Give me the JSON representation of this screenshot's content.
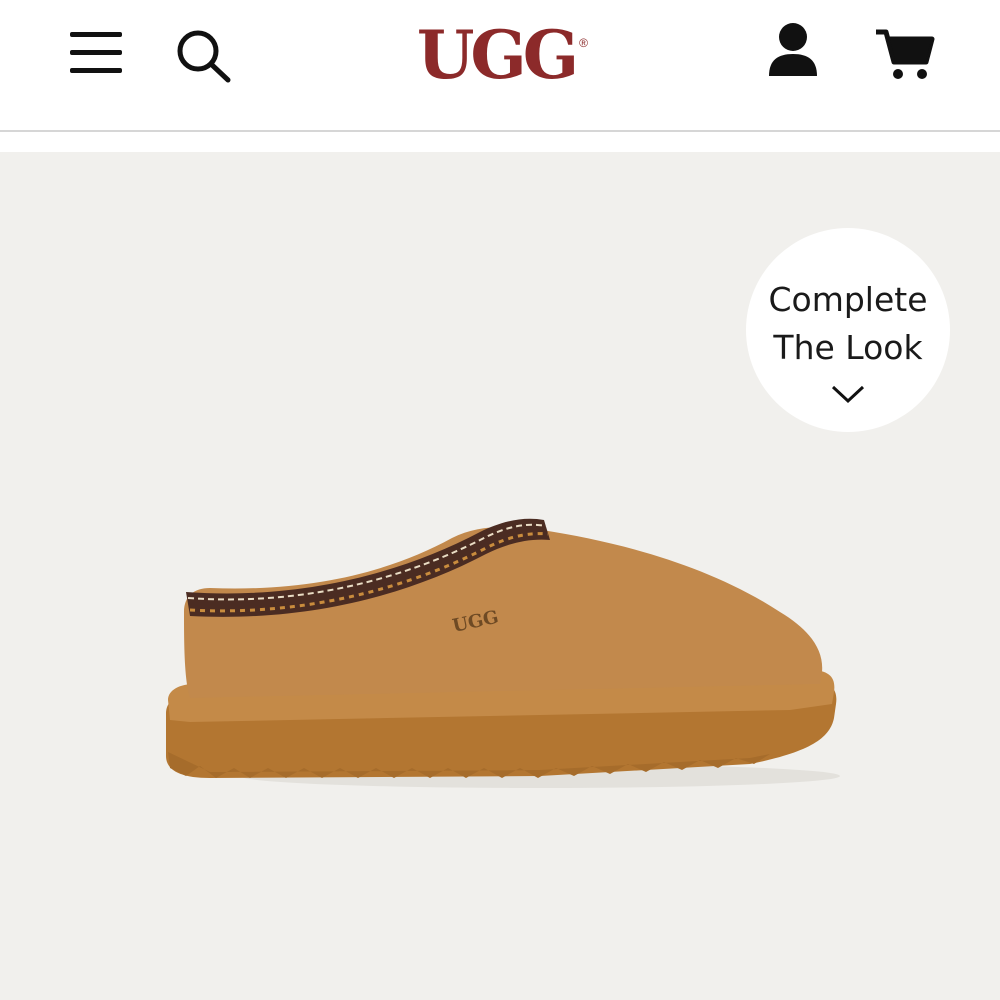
{
  "header": {
    "logo_text": "UGG",
    "logo_mark": "®",
    "icons": {
      "menu": "hamburger-menu-icon",
      "search": "search-icon",
      "account": "account-icon",
      "cart": "shopping-cart-icon"
    }
  },
  "hero": {
    "complete_the_look": {
      "line1": "Complete",
      "line2": "The Look",
      "icon": "chevron-down-icon"
    },
    "product_image": {
      "embossed_logo": "UGG"
    }
  },
  "colors": {
    "brand": "#8c2a2a",
    "hero_background": "#f1f0ed",
    "divider": "#d6d6d6"
  }
}
